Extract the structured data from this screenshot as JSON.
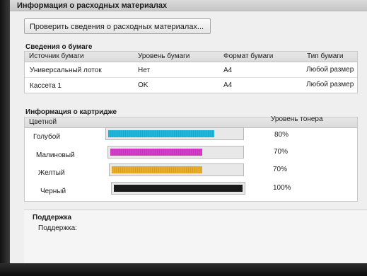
{
  "window": {
    "title": "Информация о расходных материалах"
  },
  "check_button": {
    "label": "Проверить сведения о расходных материалах..."
  },
  "paper": {
    "section_title": "Сведения о бумаге",
    "columns": [
      "Источник бумаги",
      "Уровень бумаги",
      "Формат бумаги",
      "Тип бумаги"
    ],
    "rows": [
      [
        "Универсальный лоток",
        "Нет",
        "A4",
        "Любой размер"
      ],
      [
        "Кассета 1",
        "OK",
        "A4",
        "Любой размер"
      ]
    ]
  },
  "cartridges": {
    "section_title": "Информация о картридже",
    "group_label": "Цветной",
    "level_header": "Уровень тонера",
    "items": [
      {
        "name": "Голубой",
        "level_text": "80%",
        "level": 0.8,
        "color": "#1fb6dc"
      },
      {
        "name": "Малиновый",
        "level_text": "70%",
        "level": 0.7,
        "color": "#d43bc6"
      },
      {
        "name": "Желтый",
        "level_text": "70%",
        "level": 0.7,
        "color": "#e9ac2a"
      },
      {
        "name": "Черный",
        "level_text": "100%",
        "level": 1.0,
        "color": "#1a1a1a"
      }
    ]
  },
  "support": {
    "section_title": "Поддержка",
    "label": "Поддержка:"
  }
}
